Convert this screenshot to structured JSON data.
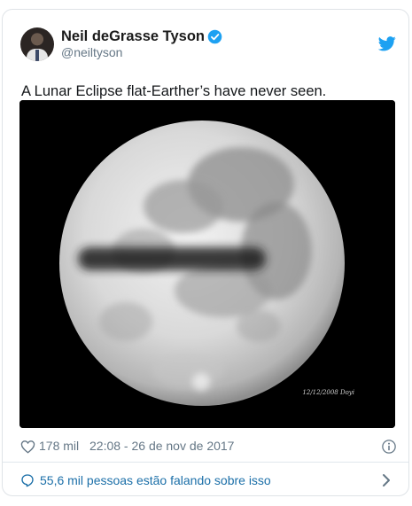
{
  "author": {
    "name": "Neil deGrasse Tyson",
    "handle": "@neiltyson"
  },
  "tweet": {
    "text": "A Lunar Eclipse flat-Earther’s have never seen.",
    "media_stamp": "12/12/2008 Doyi"
  },
  "stats": {
    "likes": "178 mil",
    "timestamp": "22:08 - 26 de nov de 2017"
  },
  "footer": {
    "talking": "55,6 mil pessoas estão falando sobre isso"
  },
  "colors": {
    "twitter_blue": "#1da1f2",
    "link_blue": "#1b6fa8",
    "muted": "#657786"
  },
  "icons": [
    "verified-badge-icon",
    "twitter-bird-icon",
    "heart-icon",
    "info-icon",
    "speech-bubble-icon",
    "chevron-right-icon"
  ]
}
